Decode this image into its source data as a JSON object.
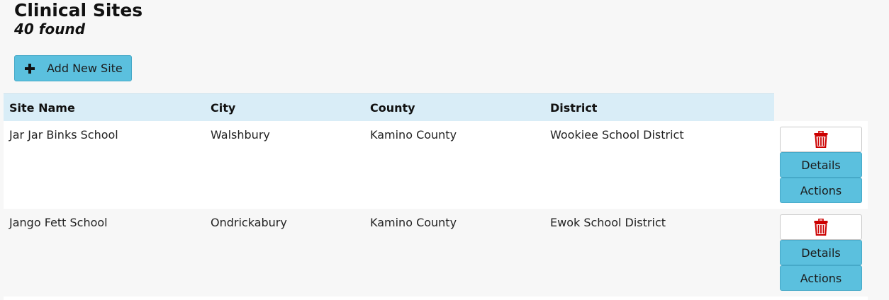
{
  "page": {
    "title": "Clinical Sites",
    "result_count": "40 found",
    "add_button_label": "Add New Site"
  },
  "colors": {
    "accent": "#5bc0de",
    "header_bg": "#d9edf7",
    "delete_icon": "#cc0000"
  },
  "table": {
    "columns": [
      "Site Name",
      "City",
      "County",
      "District"
    ],
    "rows": [
      {
        "site_name": "Jar Jar Binks School",
        "city": "Walshbury",
        "county": "Kamino County",
        "district": "Wookiee School District",
        "details_label": "Details",
        "actions_label": "Actions"
      },
      {
        "site_name": "Jango Fett School",
        "city": "Ondrickabury",
        "county": "Kamino County",
        "district": "Ewok School District",
        "details_label": "Details",
        "actions_label": "Actions"
      }
    ]
  },
  "icons": {
    "add": "plus-icon",
    "delete": "trash-icon"
  }
}
